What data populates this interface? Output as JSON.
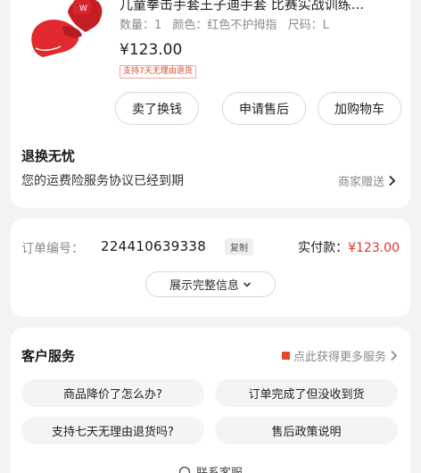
{
  "product": {
    "title": "儿童拳击手套王子迪手套 比赛实战训练...",
    "specs": {
      "qty": "数量：1",
      "color": "颜色：红色不护拇指",
      "size": "尺码：L"
    },
    "price": "¥123.00",
    "return_tag": "支持7天无理由退货",
    "actions": {
      "sell": "卖了换钱",
      "after_sale": "申请售后",
      "cart": "加购物车"
    }
  },
  "worry_free": {
    "title": "退换无忧",
    "desc": "您的运费险服务协议已经到期",
    "right": "商家赠送"
  },
  "order": {
    "label": "订单编号：",
    "number": "2244106393​38",
    "copy": "复制",
    "paid_label": "实付款：",
    "paid_amount": "¥123.00",
    "show_all": "展示完整信息"
  },
  "service": {
    "title": "客户服务",
    "more": "点此获得更多服务",
    "questions": [
      "商品降价了怎么办?",
      "订单完成了但没收到货",
      "支持七天无理由退货吗?",
      "售后政策说明"
    ],
    "contact": "联系客服"
  },
  "colors": {
    "accent_red": "#e4322b",
    "glove_red": "#d9222a"
  }
}
